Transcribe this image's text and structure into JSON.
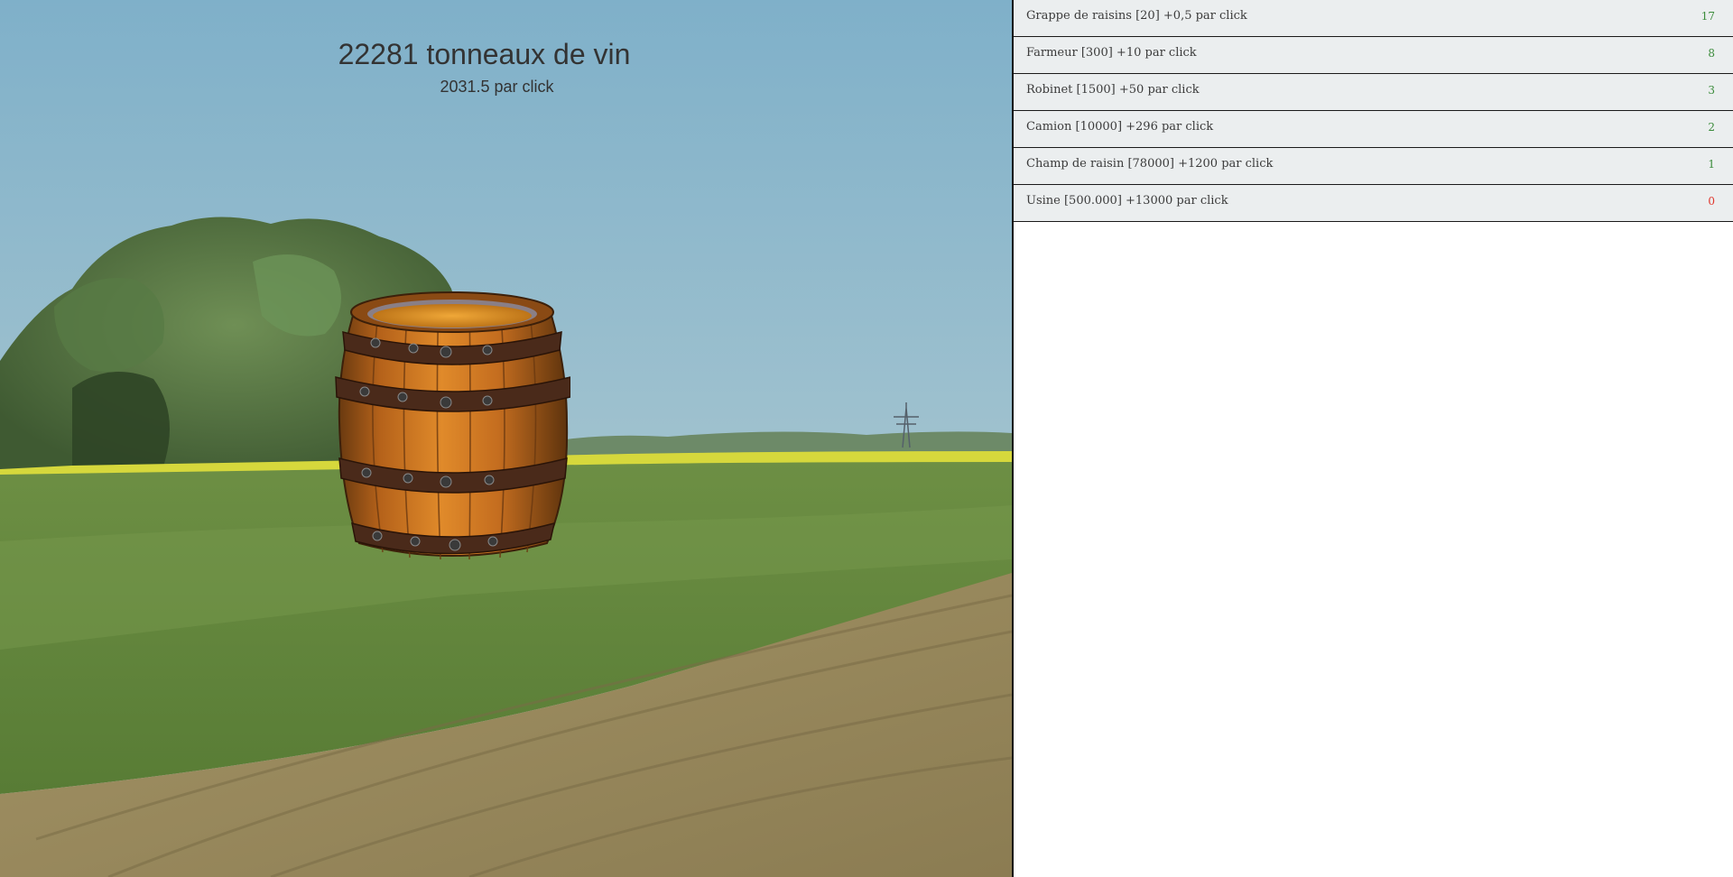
{
  "score": {
    "total_label": "22281 tonneaux de vin",
    "rate_label": "2031.5 par click"
  },
  "barrel": {
    "icon": "wine-barrel-icon"
  },
  "scene": {
    "icon": "field-landscape-background"
  },
  "store": {
    "items": [
      {
        "label": "Grappe de raisins [20] +0,5 par click",
        "count": "17",
        "count_color": "#3c8c3c"
      },
      {
        "label": "Farmeur [300] +10 par click",
        "count": "8",
        "count_color": "#3c8c3c"
      },
      {
        "label": "Robinet [1500] +50 par click",
        "count": "3",
        "count_color": "#3c8c3c"
      },
      {
        "label": "Camion [10000] +296 par click",
        "count": "2",
        "count_color": "#3c8c3c"
      },
      {
        "label": "Champ de raisin [78000] +1200 par click",
        "count": "1",
        "count_color": "#3c8c3c"
      },
      {
        "label": "Usine [500.000] +13000 par click",
        "count": "0",
        "count_color": "#e0362c"
      }
    ]
  },
  "colors": {
    "store_background": "#ebeeef",
    "owned_count": "#3c8c3c",
    "zero_count": "#e0362c"
  }
}
